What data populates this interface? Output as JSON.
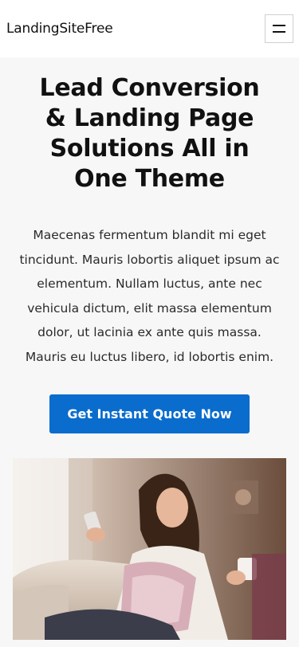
{
  "header": {
    "logo": "LandingSiteFree",
    "menu_icon": "hamburger-menu-icon"
  },
  "hero": {
    "title": "Lead Conversion & Landing Page Solutions All in One Theme",
    "body": "Maecenas fermentum blandit mi eget tincidunt. Mauris lobortis aliquet ipsum ac elementum. Nullam luctus, ante nec vehicula dictum, elit massa elementum dolor, ut lacinia ex ante quis massa. Mauris eu luctus libero, id lobortis enim.",
    "cta_label": "Get Instant Quote Now"
  },
  "colors": {
    "accent": "#0a6ccd",
    "background": "#f7f7f7",
    "header_bg": "#ffffff"
  }
}
